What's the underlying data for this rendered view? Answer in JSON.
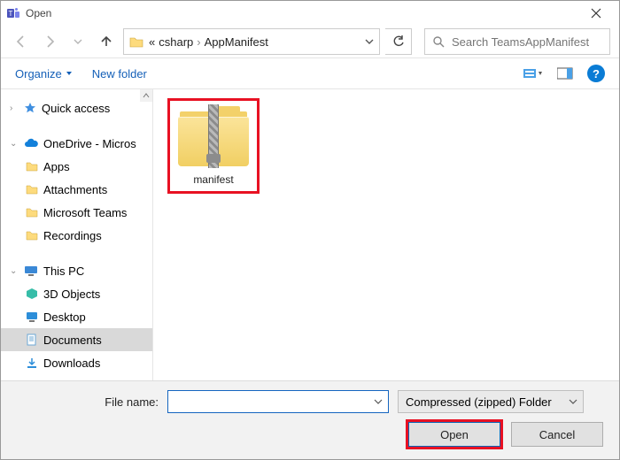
{
  "window": {
    "title": "Open"
  },
  "nav": {
    "breadcrumb_prefix": "«",
    "crumbs": [
      "csharp",
      "AppManifest"
    ],
    "search_placeholder": "Search TeamsAppManifest"
  },
  "toolbar": {
    "organize": "Organize",
    "new_folder": "New folder"
  },
  "tree": {
    "quick_access": "Quick access",
    "onedrive": "OneDrive - Micros",
    "onedrive_children": [
      "Apps",
      "Attachments",
      "Microsoft Teams",
      "Recordings"
    ],
    "this_pc": "This PC",
    "this_pc_children": [
      "3D Objects",
      "Desktop",
      "Documents",
      "Downloads"
    ],
    "selected": "Documents"
  },
  "content": {
    "files": [
      {
        "name": "manifest",
        "type": "zip",
        "selected": true
      }
    ]
  },
  "footer": {
    "filename_label": "File name:",
    "filename_value": "",
    "filter_label": "Compressed (zipped) Folder",
    "open": "Open",
    "cancel": "Cancel"
  }
}
